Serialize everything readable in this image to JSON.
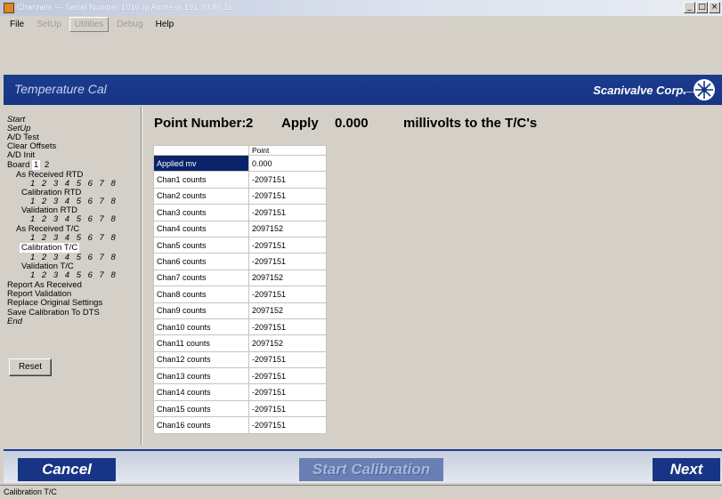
{
  "window": {
    "title": "Channels — Serial Number 1016 Ip Address 191.30.80.16",
    "controls": [
      "_",
      "□",
      "×"
    ]
  },
  "menu": [
    {
      "label": "File",
      "state": "normal"
    },
    {
      "label": "SetUp",
      "state": "disabled"
    },
    {
      "label": "Utilities",
      "state": "boxed"
    },
    {
      "label": "Debug",
      "state": "disabled"
    },
    {
      "label": "Help",
      "state": "normal"
    }
  ],
  "banner": {
    "title": "Temperature Cal",
    "brand": "Scanivalve Corp.",
    "brand_icon": "scanivalve-logo"
  },
  "nav": {
    "start": "Start",
    "setup": "SetUp",
    "ad_test": "A/D Test",
    "clear_offsets": "Clear Offsets",
    "ad_init": "A/D Init",
    "board_label": "Board",
    "board_1": "1",
    "board_2": "2",
    "as_received_rtd": "As Received RTD",
    "calibration_rtd": "Calibration RTD",
    "validation_rtd": "Validation RTD",
    "as_received_tc": "As Received T/C",
    "calibration_tc": "Calibration T/C",
    "validation_tc": "Validation T/C",
    "channel_numbers": "1 2 3 4 5 6 7 8",
    "report_as_received": "Report As Received",
    "report_validation": "Report Validation",
    "replace_original": "Replace Original Settings",
    "save_calibration": "Save Calibration To DTS",
    "end": "End",
    "reset": "Reset"
  },
  "main": {
    "header_prefix": "Point Number:",
    "point_number": "2",
    "apply_label": "Apply",
    "apply_value": "0.000",
    "units_text": "millivolts to the T/C's",
    "grid": {
      "column_header": "Point",
      "rows": [
        {
          "label": "Applied mv",
          "value": "0.000"
        },
        {
          "label": "Chan1 counts",
          "value": "-2097151"
        },
        {
          "label": "Chan2 counts",
          "value": "-2097151"
        },
        {
          "label": "Chan3 counts",
          "value": "-2097151"
        },
        {
          "label": "Chan4 counts",
          "value": "2097152"
        },
        {
          "label": "Chan5 counts",
          "value": "-2097151"
        },
        {
          "label": "Chan6 counts",
          "value": "-2097151"
        },
        {
          "label": "Chan7 counts",
          "value": "2097152"
        },
        {
          "label": "Chan8 counts",
          "value": "-2097151"
        },
        {
          "label": "Chan9 counts",
          "value": "2097152"
        },
        {
          "label": "Chan10 counts",
          "value": "-2097151"
        },
        {
          "label": "Chan11 counts",
          "value": "2097152"
        },
        {
          "label": "Chan12 counts",
          "value": "-2097151"
        },
        {
          "label": "Chan13 counts",
          "value": "-2097151"
        },
        {
          "label": "Chan14 counts",
          "value": "-2097151"
        },
        {
          "label": "Chan15 counts",
          "value": "-2097151"
        },
        {
          "label": "Chan16 counts",
          "value": "-2097151"
        }
      ]
    }
  },
  "buttons": {
    "cancel": "Cancel",
    "start_calibration": "Start Calibration",
    "next": "Next"
  },
  "status": {
    "text": "Calibration T/C"
  }
}
